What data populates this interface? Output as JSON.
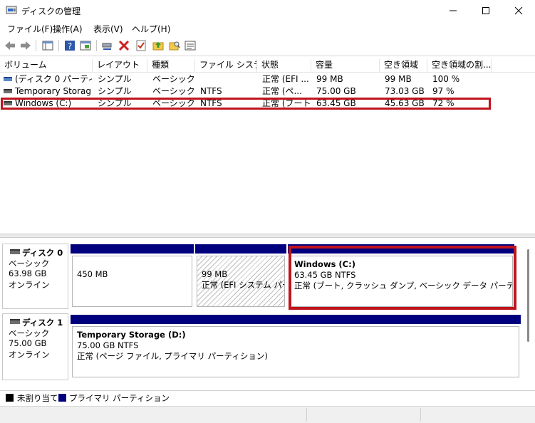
{
  "window": {
    "title": "ディスクの管理"
  },
  "menu": [
    "ファイル(F)",
    "操作(A)",
    "表示(V)",
    "ヘルプ(H)"
  ],
  "toolbar": {
    "icons": [
      "back-arrow-icon",
      "forward-arrow-icon",
      "console-tree-icon",
      "help-icon",
      "properties-icon",
      "connect-icon",
      "delete-icon",
      "check-icon",
      "up-folder-icon",
      "search-folder-icon",
      "list-icon"
    ]
  },
  "listview": {
    "columns": [
      "ボリューム",
      "レイアウト",
      "種類",
      "ファイル システム",
      "状態",
      "容量",
      "空き領域",
      "空き領域の割..."
    ],
    "rows": [
      {
        "volume": "(ディスク 0 パーティシ...",
        "layout": "シンプル",
        "type": "ベーシック",
        "fs": "",
        "status": "正常 (EFI ...",
        "capacity": "99 MB",
        "free": "99 MB",
        "pct": "100 %"
      },
      {
        "volume": "Temporary Storag...",
        "layout": "シンプル",
        "type": "ベーシック",
        "fs": "NTFS",
        "status": "正常 (ペ...",
        "capacity": "75.00 GB",
        "free": "73.03 GB",
        "pct": "97 %"
      },
      {
        "volume": "Windows (C:)",
        "layout": "シンプル",
        "type": "ベーシック",
        "fs": "NTFS",
        "status": "正常 (ブート...",
        "capacity": "63.45 GB",
        "free": "45.63 GB",
        "pct": "72 %"
      }
    ]
  },
  "disks": [
    {
      "name": "ディスク 0",
      "type": "ベーシック",
      "size": "63.98 GB",
      "state": "オンライン",
      "partitions": [
        {
          "title": "",
          "line1": "450 MB",
          "line2": ""
        },
        {
          "title": "",
          "line1": "99 MB",
          "line2": "正常 (EFI システム パーティ"
        },
        {
          "title": "Windows  (C:)",
          "line1": "63.45 GB NTFS",
          "line2": "正常 (ブート, クラッシュ ダンプ, ベーシック データ パーティション)"
        }
      ]
    },
    {
      "name": "ディスク 1",
      "type": "ベーシック",
      "size": "75.00 GB",
      "state": "オンライン",
      "partitions": [
        {
          "title": "Temporary Storage  (D:)",
          "line1": "75.00 GB NTFS",
          "line2": "正常 (ページ ファイル, プライマリ パーティション)"
        }
      ]
    }
  ],
  "legend": [
    {
      "label": "未割り当て",
      "color": "#000000"
    },
    {
      "label": "プライマリ パーティション",
      "color": "#00007e"
    }
  ],
  "colors": {
    "primary": "#00007e",
    "highlight": "#c0141d"
  }
}
